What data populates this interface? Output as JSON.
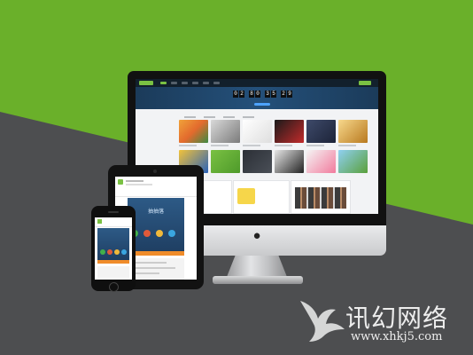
{
  "scene": {
    "background_colors": {
      "green": "#6ab02a",
      "gray": "#4d4e50"
    },
    "accent": "#7ac143"
  },
  "desktop": {
    "countdown": [
      "0",
      "2",
      "8",
      "0",
      "3",
      "5",
      "2",
      "9"
    ]
  },
  "tablet": {
    "hero_text": "抽抽落"
  },
  "watermark": {
    "name": "讯幻网络",
    "url": "www.xhkj5.com"
  }
}
